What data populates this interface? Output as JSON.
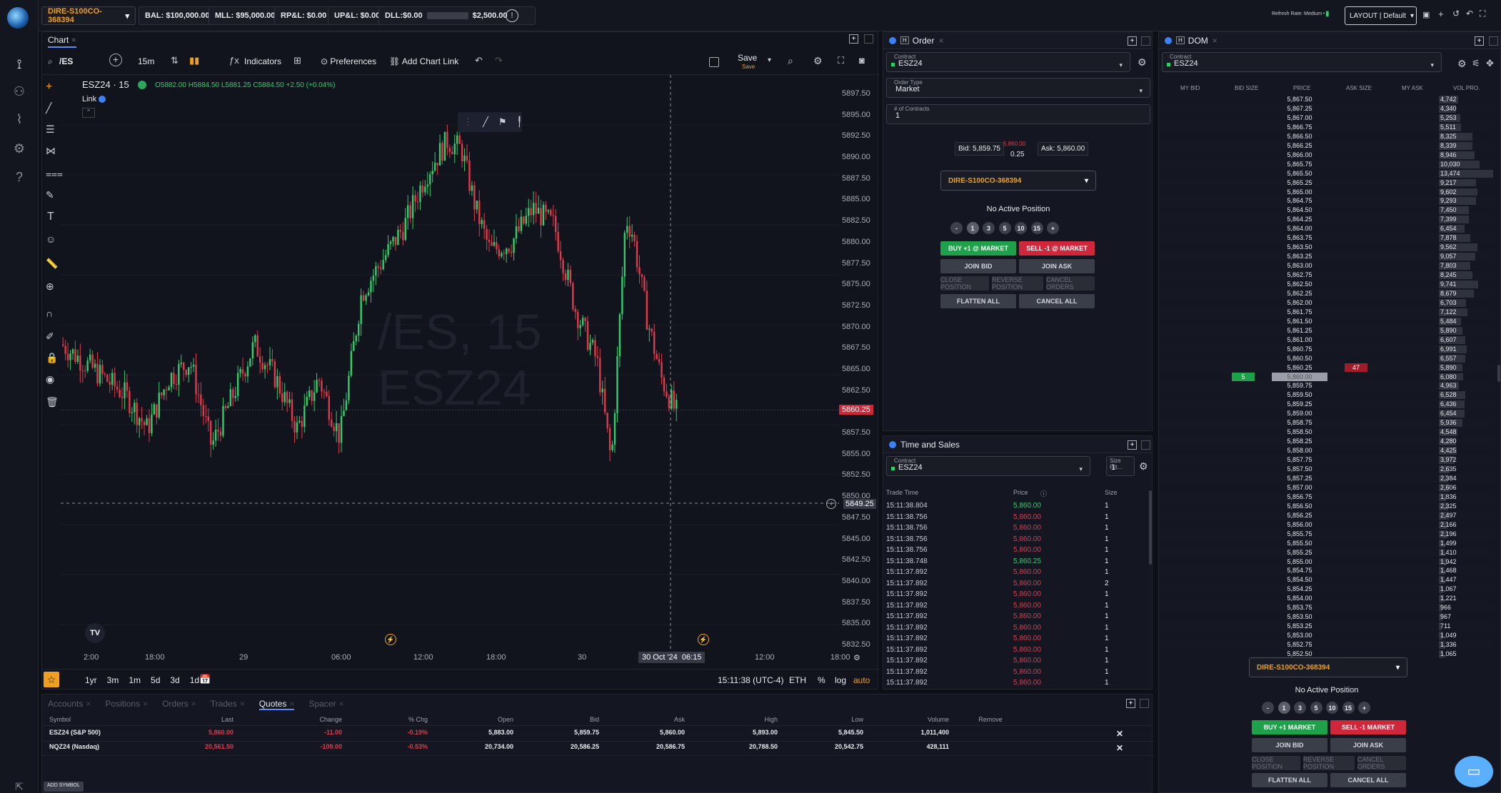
{
  "topbar": {
    "account": "DIRE-S100CO-368394",
    "bal": "BAL: $100,000.00",
    "mll": "MLL: $95,000.00",
    "rpl": "RP&L: $0.00",
    "upl": "UP&L: $0.00",
    "dll": "DLL:$0.00",
    "dll_limit": "$2,500.00",
    "refresh": "Refresh Rate: Medium",
    "layout": "LAYOUT | Default"
  },
  "chart": {
    "tab": "Chart",
    "symbol": "/ES",
    "interval": "15m",
    "indicators": "Indicators",
    "preferences": "Preferences",
    "add_link": "Add Chart Link",
    "save": "Save",
    "save_sub": "Save",
    "title": "ESZ24 · 15",
    "ohlc_o": "O5882.00",
    "ohlc_h": "H5884.50",
    "ohlc_l": "L5881.25",
    "ohlc_c": "C5884.50",
    "ohlc_chg": "+2.50 (+0.04%)",
    "link": "Link",
    "watermark1": "/ES, 15",
    "watermark2": "ESZ24",
    "last_price": "5860.25",
    "cross_price": "5849.25",
    "cross_date": "30 Oct '24",
    "cross_time": "06:15",
    "ranges": [
      "1yr",
      "3m",
      "1m",
      "5d",
      "3d",
      "1d"
    ],
    "clock": "15:11:38 (UTC-4)",
    "session": "ETH",
    "pct": "%",
    "log": "log",
    "auto": "auto",
    "y_ticks": [
      "5897.50",
      "5895.00",
      "5892.50",
      "5890.00",
      "5887.50",
      "5885.00",
      "5882.50",
      "5880.00",
      "5877.50",
      "5875.00",
      "5872.50",
      "5870.00",
      "5867.50",
      "5865.00",
      "5862.50",
      "5857.50",
      "5855.00",
      "5852.50",
      "5850.00",
      "5847.50",
      "5845.00",
      "5842.50",
      "5840.00",
      "5837.50",
      "5835.00",
      "5832.50"
    ],
    "x_ticks": [
      "2:00",
      "18:00",
      "29",
      "06:00",
      "12:00",
      "18:00",
      "30",
      "12:00",
      "18:00"
    ]
  },
  "order": {
    "title": "Order",
    "contract_label": "Contract",
    "contract": "ESZ24",
    "type_label": "Order Type",
    "type": "Market",
    "qty_label": "# of Contracts",
    "qty": "1",
    "bid": "Bid: 5,859.75",
    "ask": "Ask: 5,860.00",
    "last": "5,860.00",
    "spread": "0.25",
    "account": "DIRE-S100CO-368394",
    "position": "No Active Position",
    "qtys": [
      "-",
      "1",
      "3",
      "5",
      "10",
      "15",
      "+"
    ],
    "buy": "BUY +1 @ MARKET",
    "sell": "SELL -1 @ MARKET",
    "join_bid": "JOIN BID",
    "join_ask": "JOIN ASK",
    "close": "CLOSE POSITION",
    "reverse": "REVERSE POSITION",
    "cancel_orders": "CANCEL ORDERS",
    "flatten": "FLATTEN ALL",
    "cancel_all": "CANCEL ALL"
  },
  "tns": {
    "title": "Time and Sales",
    "contract_label": "Contract",
    "contract": "ESZ24",
    "size_label": "Size Filt...",
    "size": "1",
    "headers": [
      "Trade Time",
      "Price",
      "Size"
    ],
    "rows": [
      [
        "15:11:38.804",
        "5,860.00",
        "1",
        "g"
      ],
      [
        "15:11:38.756",
        "5,860.00",
        "1",
        "r"
      ],
      [
        "15:11:38.756",
        "5,860.00",
        "1",
        "r"
      ],
      [
        "15:11:38.756",
        "5,860.00",
        "1",
        "r"
      ],
      [
        "15:11:38.756",
        "5,860.00",
        "1",
        "r"
      ],
      [
        "15:11:38.748",
        "5,860.25",
        "1",
        "g"
      ],
      [
        "15:11:37.892",
        "5,860.00",
        "1",
        "r"
      ],
      [
        "15:11:37.892",
        "5,860.00",
        "2",
        "r"
      ],
      [
        "15:11:37.892",
        "5,860.00",
        "1",
        "r"
      ],
      [
        "15:11:37.892",
        "5,860.00",
        "1",
        "r"
      ],
      [
        "15:11:37.892",
        "5,860.00",
        "1",
        "r"
      ],
      [
        "15:11:37.892",
        "5,860.00",
        "1",
        "r"
      ],
      [
        "15:11:37.892",
        "5,860.00",
        "1",
        "r"
      ],
      [
        "15:11:37.892",
        "5,860.00",
        "1",
        "r"
      ],
      [
        "15:11:37.892",
        "5,860.00",
        "1",
        "r"
      ],
      [
        "15:11:37.892",
        "5,860.00",
        "1",
        "r"
      ],
      [
        "15:11:37.892",
        "5,860.00",
        "1",
        "r"
      ]
    ]
  },
  "dom": {
    "title": "DOM",
    "contract_label": "Contract",
    "contract": "ESZ24",
    "headers": [
      "MY BID",
      "BID SIZE",
      "PRICE",
      "ASK SIZE",
      "MY ASK",
      "VOL PRO."
    ],
    "bid_size": "5",
    "ask_size": "47",
    "current": "5,860.00",
    "rows": [
      [
        "5,867.50",
        "4,742"
      ],
      [
        "5,867.25",
        "4,340"
      ],
      [
        "5,867.00",
        "5,253"
      ],
      [
        "5,866.75",
        "5,511"
      ],
      [
        "5,866.50",
        "8,325"
      ],
      [
        "5,866.25",
        "8,339"
      ],
      [
        "5,866.00",
        "8,946"
      ],
      [
        "5,865.75",
        "10,030"
      ],
      [
        "5,865.50",
        "13,474"
      ],
      [
        "5,865.25",
        "9,217"
      ],
      [
        "5,865.00",
        "9,602"
      ],
      [
        "5,864.75",
        "9,293"
      ],
      [
        "5,864.50",
        "7,450"
      ],
      [
        "5,864.25",
        "7,399"
      ],
      [
        "5,864.00",
        "6,454"
      ],
      [
        "5,863.75",
        "7,878"
      ],
      [
        "5,863.50",
        "9,562"
      ],
      [
        "5,863.25",
        "9,057"
      ],
      [
        "5,863.00",
        "7,803"
      ],
      [
        "5,862.75",
        "8,245"
      ],
      [
        "5,862.50",
        "9,741"
      ],
      [
        "5,862.25",
        "8,679"
      ],
      [
        "5,862.00",
        "6,703"
      ],
      [
        "5,861.75",
        "7,122"
      ],
      [
        "5,861.50",
        "5,484"
      ],
      [
        "5,861.25",
        "5,890"
      ],
      [
        "5,861.00",
        "6,607"
      ],
      [
        "5,860.75",
        "6,991"
      ],
      [
        "5,860.50",
        "6,557"
      ],
      [
        "5,860.25",
        "5,890"
      ],
      [
        "5,860.00",
        "6,080"
      ],
      [
        "5,859.75",
        "4,963"
      ],
      [
        "5,859.50",
        "6,528"
      ],
      [
        "5,859.25",
        "6,436"
      ],
      [
        "5,859.00",
        "6,454"
      ],
      [
        "5,858.75",
        "5,936"
      ],
      [
        "5,858.50",
        "4,548"
      ],
      [
        "5,858.25",
        "4,280"
      ],
      [
        "5,858.00",
        "4,425"
      ],
      [
        "5,857.75",
        "3,972"
      ],
      [
        "5,857.50",
        "2,635"
      ],
      [
        "5,857.25",
        "2,384"
      ],
      [
        "5,857.00",
        "2,606"
      ],
      [
        "5,856.75",
        "1,836"
      ],
      [
        "5,856.50",
        "2,325"
      ],
      [
        "5,856.25",
        "2,497"
      ],
      [
        "5,856.00",
        "2,166"
      ],
      [
        "5,855.75",
        "2,196"
      ],
      [
        "5,855.50",
        "1,499"
      ],
      [
        "5,855.25",
        "1,410"
      ],
      [
        "5,855.00",
        "1,942"
      ],
      [
        "5,854.75",
        "1,468"
      ],
      [
        "5,854.50",
        "1,447"
      ],
      [
        "5,854.25",
        "1,067"
      ],
      [
        "5,854.00",
        "1,221"
      ],
      [
        "5,853.75",
        "966"
      ],
      [
        "5,853.50",
        "967"
      ],
      [
        "5,853.25",
        "711"
      ],
      [
        "5,853.00",
        "1,049"
      ],
      [
        "5,852.75",
        "1,336"
      ],
      [
        "5,852.50",
        "1,065"
      ]
    ],
    "account": "DIRE-S100CO-368394",
    "position": "No Active Position",
    "qtys": [
      "-",
      "1",
      "3",
      "5",
      "10",
      "15",
      "+"
    ],
    "buy": "BUY +1 MARKET",
    "sell": "SELL -1 MARKET",
    "join_bid": "JOIN BID",
    "join_ask": "JOIN ASK",
    "close": "CLOSE POSITION",
    "reverse": "REVERSE POSITION",
    "cancel_orders": "CANCEL ORDERS",
    "flatten": "FLATTEN ALL",
    "cancel_all": "CANCEL ALL"
  },
  "bottom": {
    "tabs": [
      "Accounts",
      "Positions",
      "Orders",
      "Trades",
      "Quotes",
      "Spacer"
    ],
    "active": "Quotes",
    "headers": [
      "Symbol",
      "Last",
      "Change",
      "% Chg",
      "Open",
      "Bid",
      "Ask",
      "High",
      "Low",
      "Volume",
      "Remove"
    ],
    "rows": [
      [
        "ESZ24 (S&P 500)",
        "5,860.00",
        "-11.00",
        "-0.19%",
        "5,883.00",
        "5,859.75",
        "5,860.00",
        "5,893.00",
        "5,845.50",
        "1,011,400"
      ],
      [
        "NQZ24 (Nasdaq)",
        "20,561.50",
        "-109.00",
        "-0.53%",
        "20,734.00",
        "20,586.25",
        "20,586.75",
        "20,788.50",
        "20,542.75",
        "428,111"
      ]
    ],
    "add_symbol": "ADD SYMBOL"
  },
  "colors": {
    "up": "#2fcf6c",
    "down": "#e23a4c",
    "accent": "#f0a020",
    "bg": "#0e1017"
  }
}
